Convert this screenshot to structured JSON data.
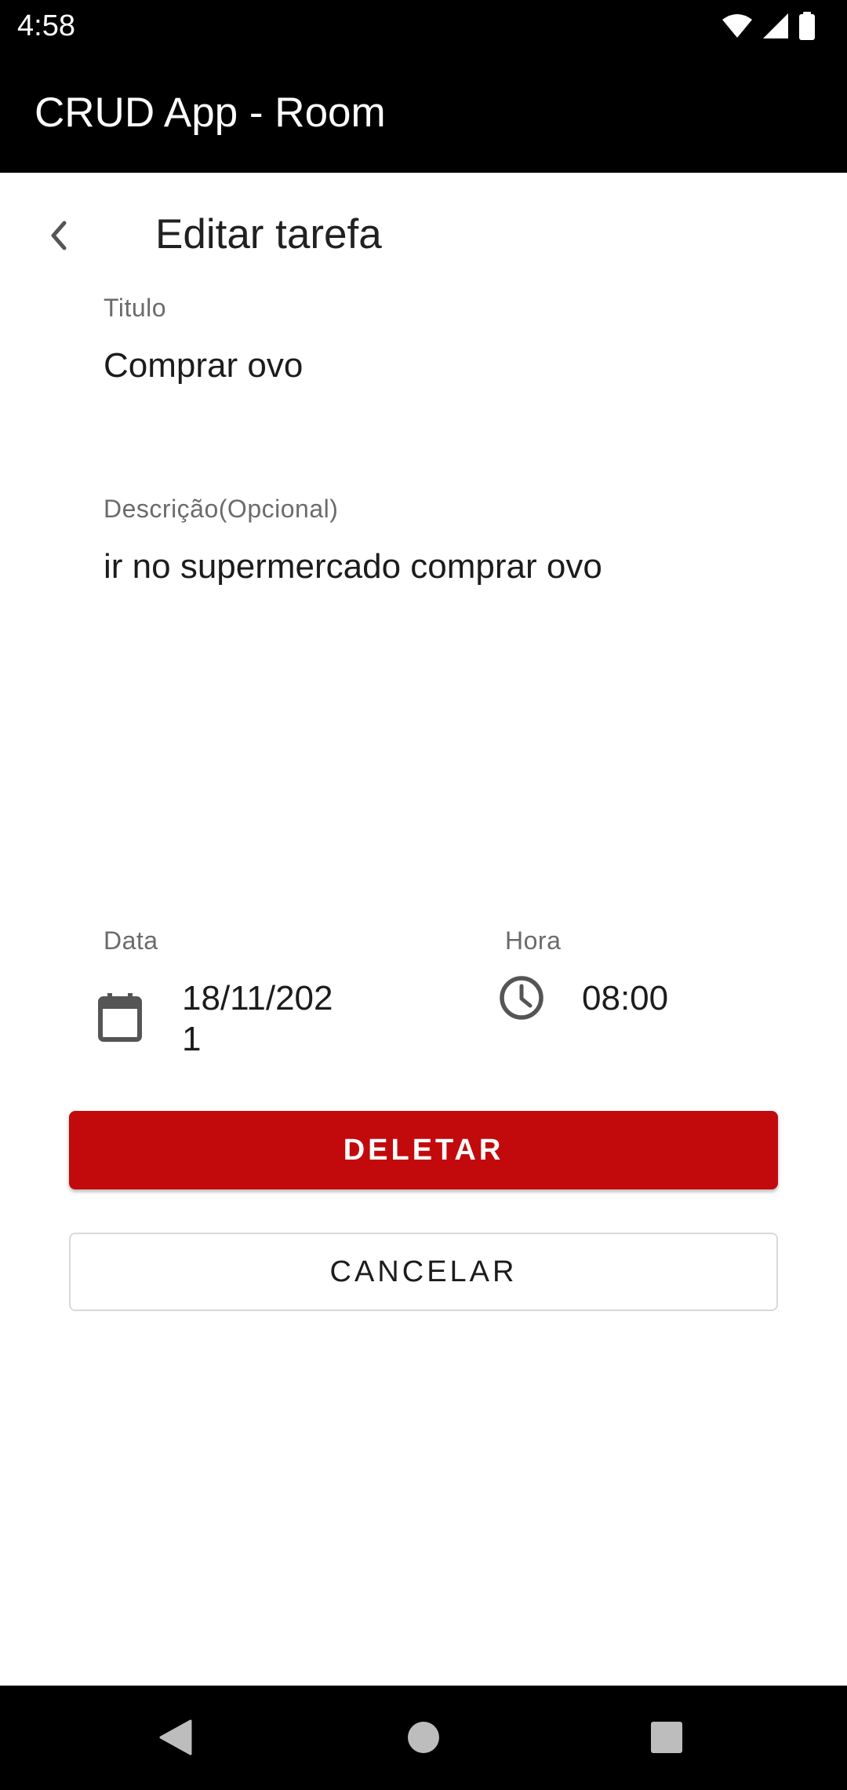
{
  "status_bar": {
    "time": "4:58",
    "icons": [
      "wifi-icon",
      "cell-signal-icon",
      "battery-icon"
    ]
  },
  "app_bar": {
    "title": "CRUD App - Room"
  },
  "header": {
    "back_icon": "chevron-left-icon",
    "title": "Editar tarefa"
  },
  "form": {
    "titulo": {
      "label": "Titulo",
      "value": "Comprar ovo"
    },
    "descricao": {
      "label": "Descrição(Opcional)",
      "value": "ir no supermercado comprar ovo"
    },
    "data": {
      "label": "Data",
      "icon": "calendar-icon",
      "value_line1": "18/11/202",
      "value_line2": "1"
    },
    "hora": {
      "label": "Hora",
      "icon": "clock-icon",
      "value": "08:00"
    }
  },
  "buttons": {
    "delete_label": "DELETAR",
    "cancel_label": "CANCELAR"
  },
  "colors": {
    "delete_button": "#c20a0c",
    "app_bar": "#000000"
  },
  "nav_bar": {
    "icons": [
      "back-triangle-icon",
      "home-circle-icon",
      "recents-square-icon"
    ]
  }
}
